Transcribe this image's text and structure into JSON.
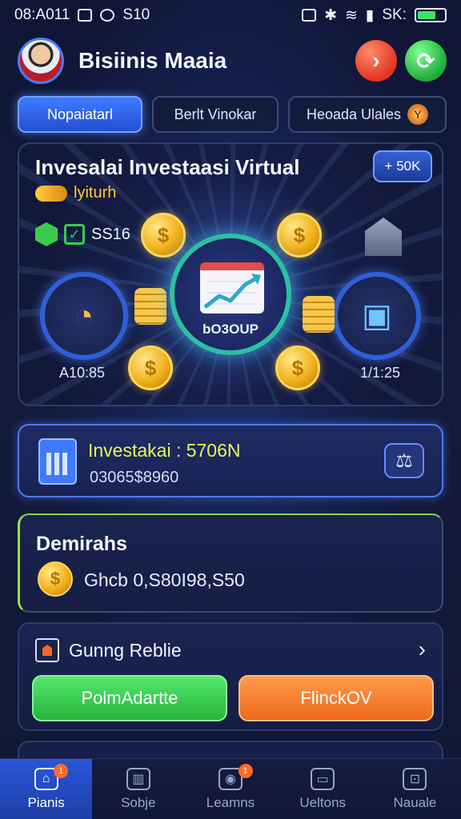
{
  "status_bar": {
    "time_text": "08:A011",
    "left_icons": [
      "notification-n-icon",
      "alarm-icon"
    ],
    "left_extra": "S10",
    "right_text": "SK:",
    "battery_level": 0.7,
    "battery_color": "#3be36b"
  },
  "header": {
    "title": "Bisiinis Maaia",
    "left_button_icon": "chevron-right-icon",
    "right_button_icon": "refresh-icon",
    "colors": {
      "left_button": "#e2351f",
      "right_button": "#1faa3a"
    }
  },
  "tabs": [
    {
      "label": "Nopaiatarl",
      "active": true
    },
    {
      "label": "Berlt Vinokar",
      "active": false
    },
    {
      "label": "Heoada Ulales",
      "active": false,
      "badge_icon": "y-badge-icon"
    }
  ],
  "hero": {
    "title": "Invesalai Investaasi Virtual",
    "subtitle": "lyiturh",
    "pill_label": "+ 50K",
    "stat_value": "SS16",
    "center_label": "bO3OUP",
    "left_label": "A10:85",
    "right_label": "1/1:25",
    "coin_symbol": "$"
  },
  "invest_card": {
    "title": "Investakai : 5706N",
    "value": "03065$8960",
    "icon": "calculator-icon",
    "action_icon": "scale-icon"
  },
  "balance_card": {
    "title": "Demirahs",
    "coin_symbol": "$",
    "value": "Ghcb 0,S80I98,S50"
  },
  "actions_card": {
    "title": "Gunng Reblie",
    "left_button": "PolmAdartte",
    "right_button": "FlinckOV",
    "colors": {
      "left": "#27b43f",
      "right": "#ee6a1d"
    }
  },
  "bottom_nav": [
    {
      "label": "Pianis",
      "icon": "home-icon",
      "active": true,
      "badge": "1"
    },
    {
      "label": "Sobje",
      "icon": "chart-icon",
      "active": false
    },
    {
      "label": "Leamns",
      "icon": "learn-icon",
      "active": false,
      "badge": "1"
    },
    {
      "label": "Ueltons",
      "icon": "wallet-icon",
      "active": false
    },
    {
      "label": "Nauale",
      "icon": "lock-icon",
      "active": false
    }
  ]
}
